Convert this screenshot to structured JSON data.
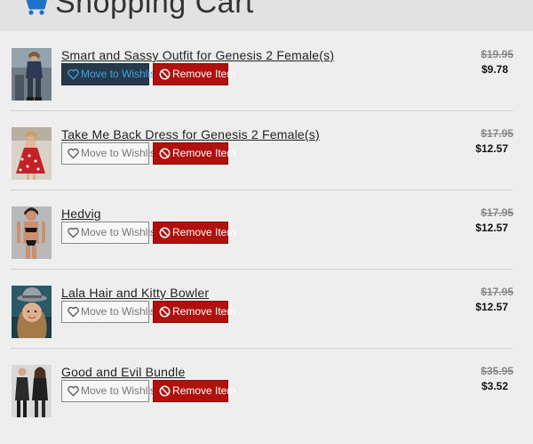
{
  "header": {
    "title": "Shopping Cart",
    "icon": "shopping-cart-icon",
    "accent": "#1e72c8"
  },
  "actions": {
    "wishlist_label": "Move to Wishlist",
    "remove_label": "Remove Item"
  },
  "items": [
    {
      "name": "Smart and Sassy Outfit for Genesis 2 Female(s)",
      "original_price": "$19.95",
      "price": "$9.78",
      "wishlist_active": true
    },
    {
      "name": "Take Me Back Dress for Genesis 2 Female(s)",
      "original_price": "$17.95",
      "price": "$12.57",
      "wishlist_active": false
    },
    {
      "name": "Hedvig",
      "original_price": "$17.95",
      "price": "$12.57",
      "wishlist_active": false
    },
    {
      "name": "Lala Hair and Kitty Bowler",
      "original_price": "$17.95",
      "price": "$12.57",
      "wishlist_active": false
    },
    {
      "name": "Good and Evil Bundle",
      "original_price": "$35.95",
      "price": "$3.52",
      "wishlist_active": false
    }
  ],
  "colors": {
    "remove_button": "#b0110d",
    "wishlist_active_bg": "#263a4c",
    "wishlist_active_text": "#3ea2e0"
  }
}
